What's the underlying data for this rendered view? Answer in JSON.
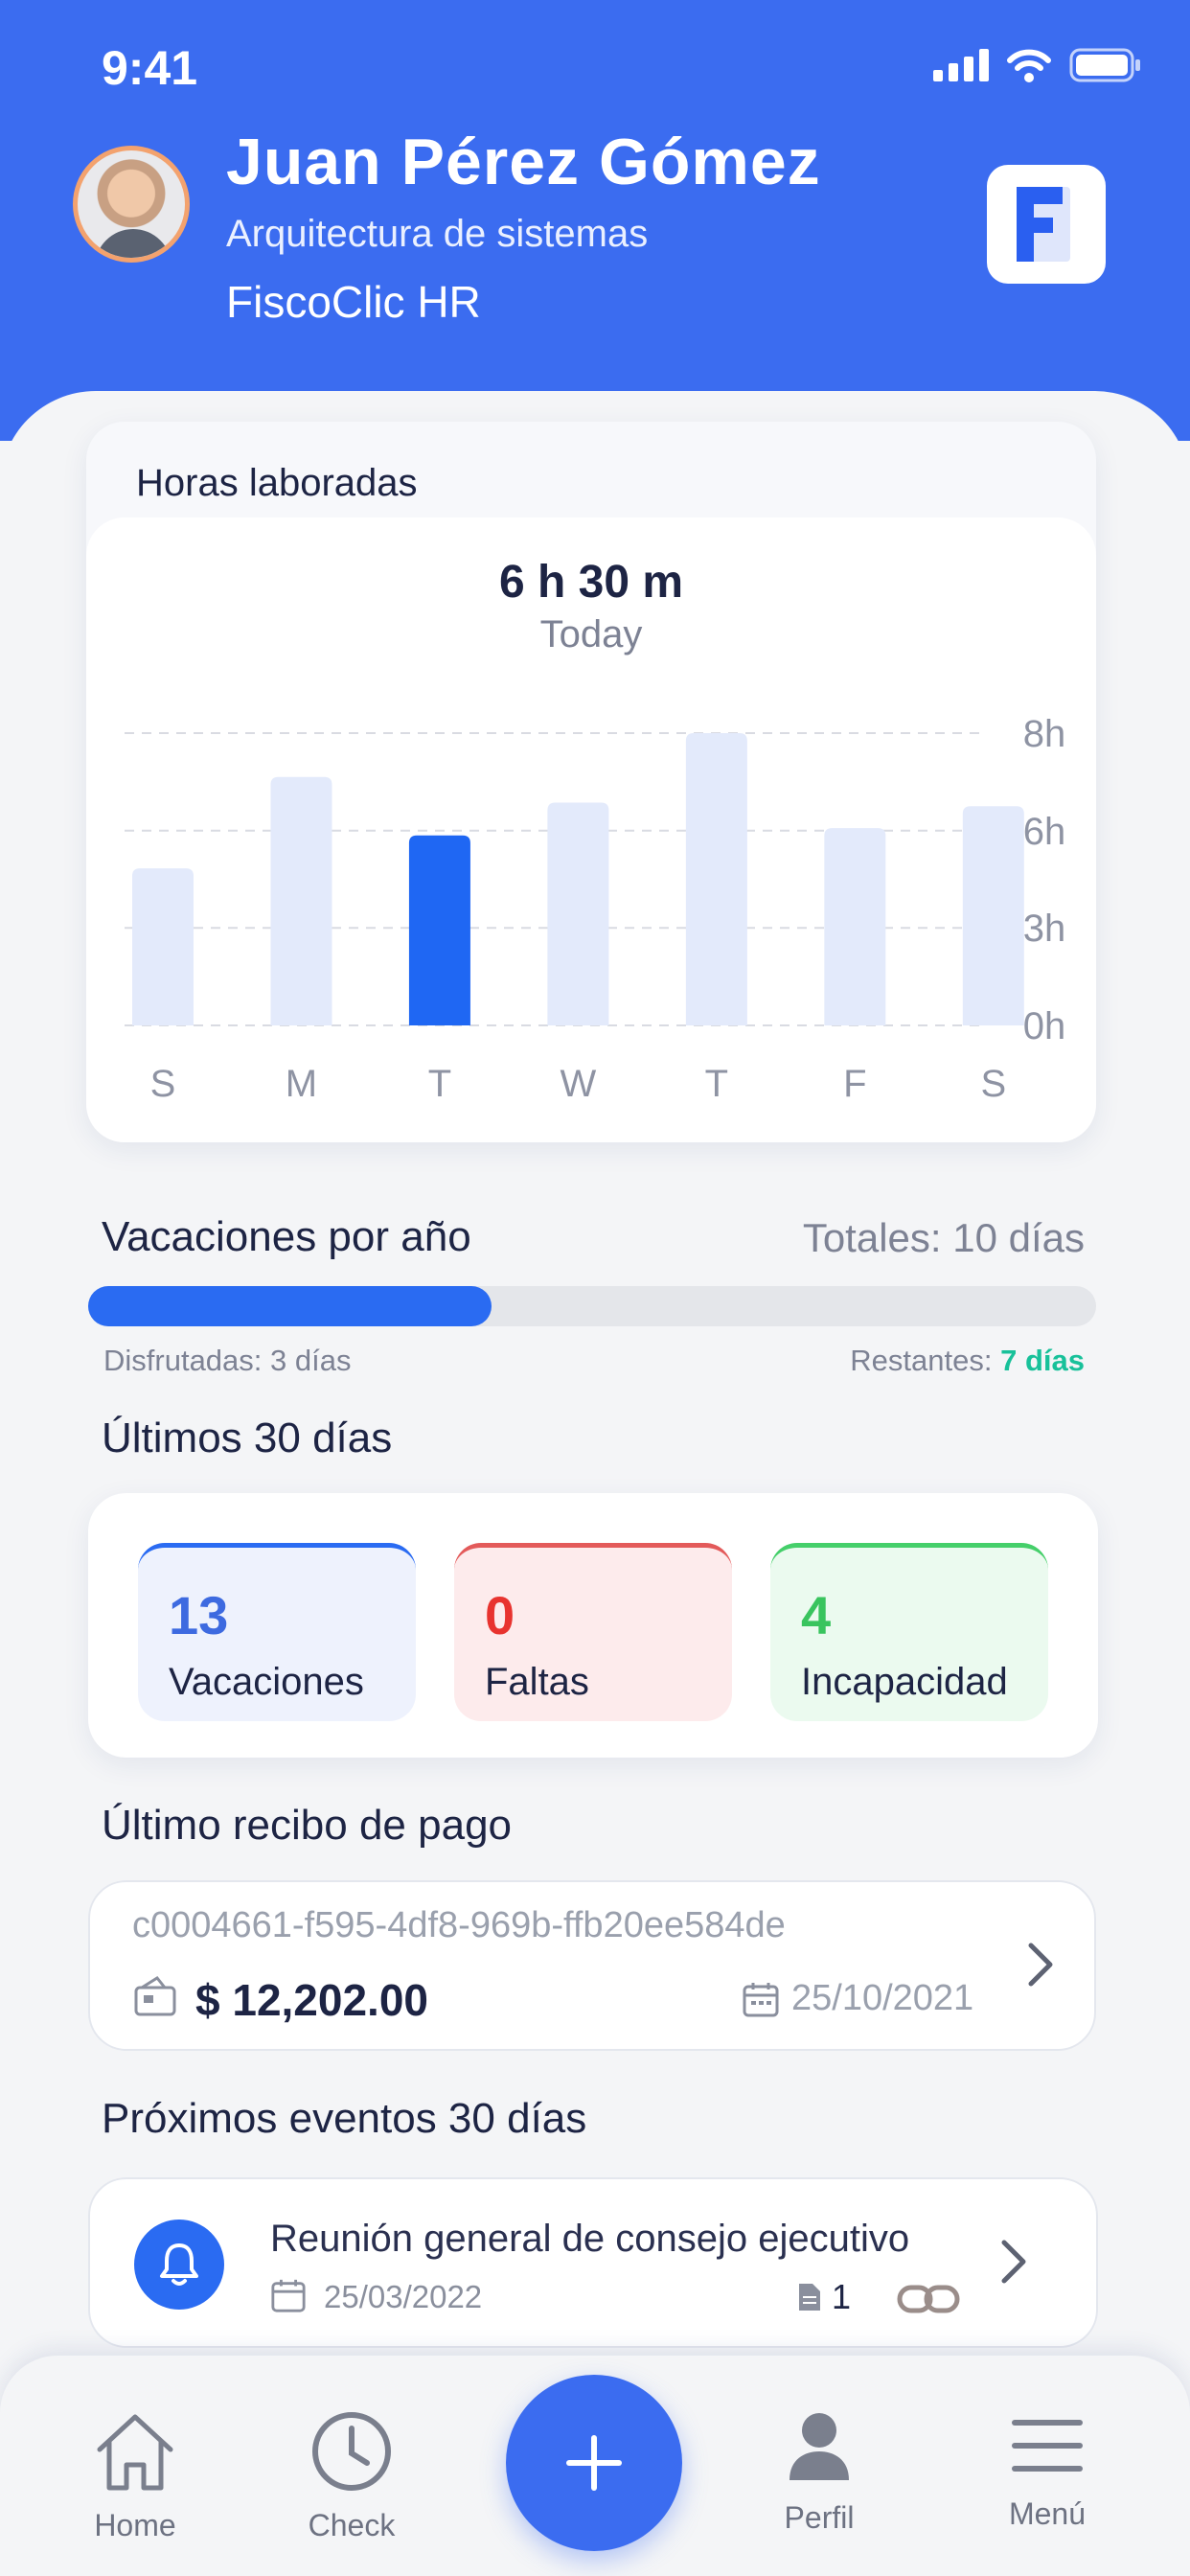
{
  "status_bar": {
    "time": "9:41"
  },
  "profile": {
    "name": "Juan Pérez Gómez",
    "role": "Arquitectura de sistemas",
    "company": "FiscoClic HR",
    "logo_letter": "F"
  },
  "hours": {
    "title": "Horas laboradas",
    "value": "6 h 30 m",
    "period": "Today"
  },
  "chart_data": {
    "type": "bar",
    "categories": [
      "S",
      "M",
      "T",
      "W",
      "T",
      "F",
      "S"
    ],
    "values": [
      4.3,
      6.8,
      5.2,
      6.1,
      8.0,
      5.4,
      6.0
    ],
    "highlight_index": 2,
    "y_tick_labels": [
      "8h",
      "6h",
      "3h",
      "0h"
    ],
    "y_tick_values": [
      8,
      5.33,
      2.67,
      0
    ],
    "ylim": [
      0,
      8
    ],
    "grid": true,
    "colors": {
      "bar": "#e3eafb",
      "highlight": "#1f67f3"
    }
  },
  "vacations": {
    "title": "Vacaciones por año",
    "total": "Totales: 10 días",
    "used_label": "Disfrutadas: 3 días",
    "left_prefix": "Restantes: ",
    "left_value": "7 días",
    "progress": 0.4
  },
  "last30": {
    "title": "Últimos 30 días",
    "items": [
      {
        "value": "13",
        "label": "Vacaciones"
      },
      {
        "value": "0",
        "label": "Faltas"
      },
      {
        "value": "4",
        "label": "Incapacidad"
      }
    ]
  },
  "receipt": {
    "title": "Último recibo de pago",
    "id": "c0004661-f595-4df8-969b-ffb20ee584de",
    "amount": "$ 12,202.00",
    "date": "25/10/2021"
  },
  "events": {
    "title": "Próximos eventos 30 días",
    "items": [
      {
        "title": "Reunión general de consejo ejecutivo",
        "date": "25/03/2022",
        "docs": "1"
      }
    ]
  },
  "nav": {
    "home": "Home",
    "check": "Check",
    "profile": "Perfil",
    "menu": "Menú"
  }
}
